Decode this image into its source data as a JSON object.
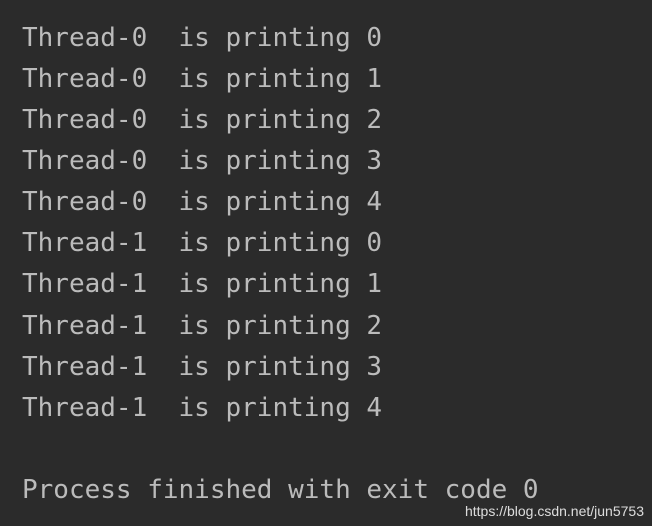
{
  "console": {
    "lines": [
      "Thread-0  is printing 0",
      "Thread-0  is printing 1",
      "Thread-0  is printing 2",
      "Thread-0  is printing 3",
      "Thread-0  is printing 4",
      "Thread-1  is printing 0",
      "Thread-1  is printing 1",
      "Thread-1  is printing 2",
      "Thread-1  is printing 3",
      "Thread-1  is printing 4"
    ],
    "status": "Process finished with exit code 0"
  },
  "watermark": "https://blog.csdn.net/jun5753"
}
